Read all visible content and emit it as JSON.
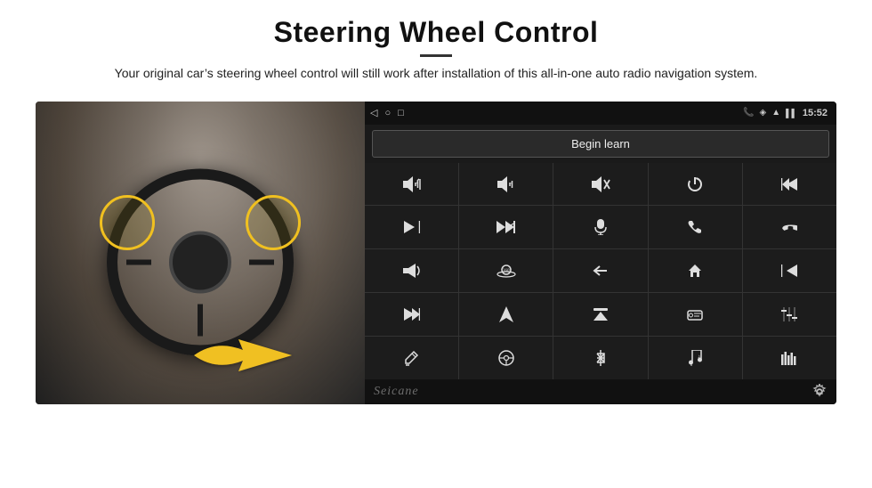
{
  "header": {
    "title": "Steering Wheel Control",
    "subtitle": "Your original car’s steering wheel control will still work after installation of this all-in-one auto radio navigation system."
  },
  "status_bar": {
    "time": "15:52",
    "back_icon": "◁",
    "home_icon": "○",
    "square_icon": "□"
  },
  "begin_learn": {
    "label": "Begin learn"
  },
  "grid": {
    "cells": [
      {
        "id": "vol-up",
        "icon": "vol_up"
      },
      {
        "id": "vol-down",
        "icon": "vol_down"
      },
      {
        "id": "mute",
        "icon": "mute"
      },
      {
        "id": "power",
        "icon": "power"
      },
      {
        "id": "prev-track",
        "icon": "prev_track"
      },
      {
        "id": "skip-next",
        "icon": "skip_next"
      },
      {
        "id": "ff",
        "icon": "fast_forward"
      },
      {
        "id": "mic",
        "icon": "mic"
      },
      {
        "id": "phone",
        "icon": "phone"
      },
      {
        "id": "end-call",
        "icon": "end_call"
      },
      {
        "id": "horn",
        "icon": "horn"
      },
      {
        "id": "360",
        "icon": "360"
      },
      {
        "id": "back",
        "icon": "back_arrow"
      },
      {
        "id": "home2",
        "icon": "home"
      },
      {
        "id": "rw",
        "icon": "rewind"
      },
      {
        "id": "skip-ff",
        "icon": "skip_ff"
      },
      {
        "id": "nav",
        "icon": "navigate"
      },
      {
        "id": "eject",
        "icon": "eject"
      },
      {
        "id": "radio",
        "icon": "radio"
      },
      {
        "id": "eq",
        "icon": "equalizer"
      },
      {
        "id": "pen",
        "icon": "pen"
      },
      {
        "id": "steering",
        "icon": "steering"
      },
      {
        "id": "bluetooth",
        "icon": "bluetooth"
      },
      {
        "id": "music",
        "icon": "music"
      },
      {
        "id": "bars",
        "icon": "bars"
      }
    ]
  },
  "branding": {
    "label": "Seicane"
  }
}
